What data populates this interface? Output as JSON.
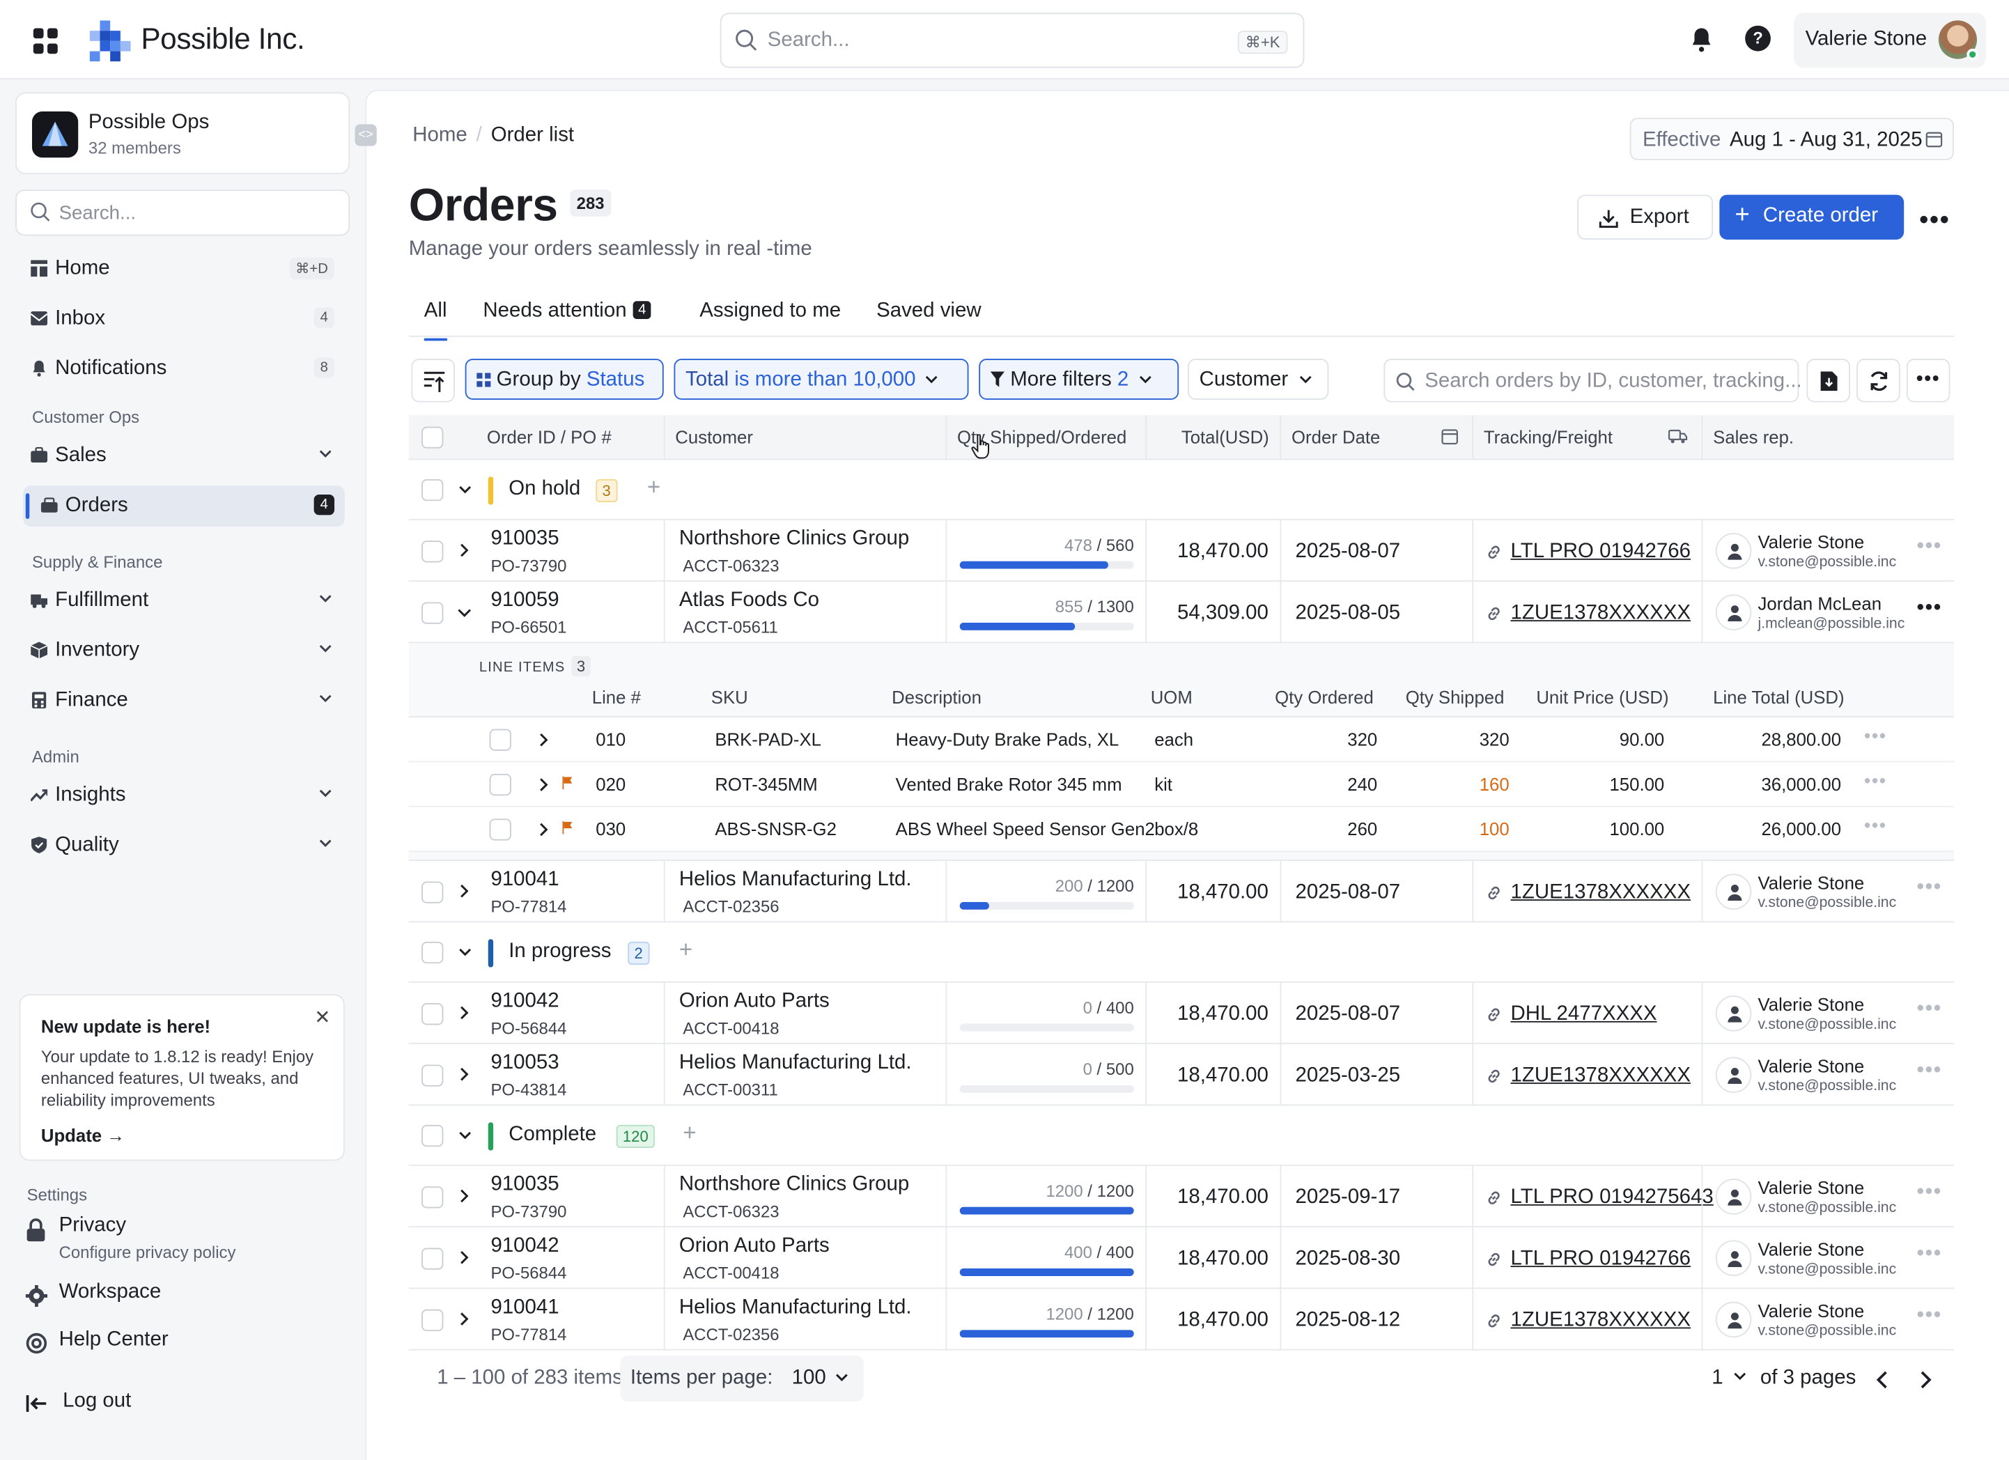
{
  "brand": {
    "name": "Possible Inc."
  },
  "top_search": {
    "placeholder": "Search...",
    "shortcut": "⌘+K"
  },
  "user": {
    "name": "Valerie Stone"
  },
  "workspace": {
    "name": "Possible Ops",
    "members": "32 members"
  },
  "sidebar": {
    "search_placeholder": "Search...",
    "home": {
      "label": "Home",
      "badge": "⌘+D"
    },
    "inbox": {
      "label": "Inbox",
      "badge": "4"
    },
    "notifications": {
      "label": "Notifications",
      "badge": "8"
    },
    "section_customer_ops": "Customer Ops",
    "sales": {
      "label": "Sales"
    },
    "orders": {
      "label": "Orders",
      "badge": "4"
    },
    "section_supply": "Supply & Finance",
    "fulfillment": {
      "label": "Fulfillment"
    },
    "inventory": {
      "label": "Inventory"
    },
    "finance": {
      "label": "Finance"
    },
    "section_admin": "Admin",
    "insights": {
      "label": "Insights"
    },
    "quality": {
      "label": "Quality"
    },
    "update": {
      "title": "New update is here!",
      "body": "Your update to 1.8.12 is ready! Enjoy enhanced features, UI tweaks, and reliability improvements",
      "link": "Update →"
    },
    "settings_label": "Settings",
    "privacy": {
      "label": "Privacy",
      "sub": "Configure privacy policy"
    },
    "workspace_item": "Workspace",
    "help_center": "Help Center",
    "logout": "Log out"
  },
  "breadcrumb": {
    "home": "Home",
    "current": "Order list"
  },
  "effective": {
    "label": "Effective",
    "range": "Aug 1 - Aug 31, 2025"
  },
  "page": {
    "title": "Orders",
    "count": "283",
    "subtitle": "Manage your orders seamlessly in real -time"
  },
  "actions": {
    "export": "Export",
    "create": "Create order"
  },
  "tabs": {
    "all": "All",
    "needs_attention": "Needs attention",
    "needs_attention_count": "4",
    "assigned": "Assigned to me",
    "saved": "Saved view"
  },
  "filters": {
    "group_by": "Group by",
    "group_by_value": "Status",
    "total": "Total",
    "total_op": "is more than",
    "total_value": "10,000",
    "more": "More filters",
    "more_count": "2",
    "customer": "Customer",
    "search_placeholder": "Search orders by ID, customer, tracking..."
  },
  "columns": {
    "order": "Order ID / PO #",
    "customer": "Customer",
    "qty": "Qty Shipped/Ordered",
    "total": "Total(USD)",
    "date": "Order Date",
    "tracking": "Tracking/Freight",
    "rep": "Sales rep."
  },
  "groups": {
    "on_hold": {
      "label": "On hold",
      "count": "3",
      "color": "#f2c230"
    },
    "in_progress": {
      "label": "In progress",
      "count": "2",
      "color": "#1f5fa8"
    },
    "complete": {
      "label": "Complete",
      "count": "120",
      "color": "#27a05a"
    }
  },
  "orders": [
    {
      "id": "910035",
      "po": "PO-73790",
      "customer": "Northshore Clinics Group",
      "acct": "ACCT-06323",
      "shipped": "478",
      "ordered": "560",
      "progress": 0.85,
      "total": "18,470.00",
      "date": "2025-08-07",
      "tracking": "LTL PRO 01942766",
      "rep": "Valerie Stone",
      "email": "v.stone@possible.inc"
    },
    {
      "id": "910059",
      "po": "PO-66501",
      "customer": "Atlas Foods Co",
      "acct": "ACCT-05611",
      "shipped": "855",
      "ordered": "1300",
      "progress": 0.66,
      "total": "54,309.00",
      "date": "2025-08-05",
      "tracking": "1ZUE1378XXXXXX",
      "rep": "Jordan McLean",
      "email": "j.mclean@possible.inc"
    },
    {
      "id": "910041",
      "po": "PO-77814",
      "customer": "Helios Manufacturing Ltd.",
      "acct": "ACCT-02356",
      "shipped": "200",
      "ordered": "1200",
      "progress": 0.17,
      "total": "18,470.00",
      "date": "2025-08-07",
      "tracking": "1ZUE1378XXXXXX",
      "rep": "Valerie Stone",
      "email": "v.stone@possible.inc"
    },
    {
      "id": "910042",
      "po": "PO-56844",
      "customer": "Orion Auto Parts",
      "acct": "ACCT-00418",
      "shipped": "0",
      "ordered": "400",
      "progress": 0,
      "total": "18,470.00",
      "date": "2025-08-07",
      "tracking": "DHL 2477XXXX",
      "rep": "Valerie Stone",
      "email": "v.stone@possible.inc"
    },
    {
      "id": "910053",
      "po": "PO-43814",
      "customer": "Helios Manufacturing Ltd.",
      "acct": "ACCT-00311",
      "shipped": "0",
      "ordered": "500",
      "progress": 0,
      "total": "18,470.00",
      "date": "2025-03-25",
      "tracking": "1ZUE1378XXXXXX",
      "rep": "Valerie Stone",
      "email": "v.stone@possible.inc"
    },
    {
      "id": "910035",
      "po": "PO-73790",
      "customer": "Northshore Clinics Group",
      "acct": "ACCT-06323",
      "shipped": "1200",
      "ordered": "1200",
      "progress": 1,
      "total": "18,470.00",
      "date": "2025-09-17",
      "tracking": "LTL PRO 0194275643",
      "rep": "Valerie Stone",
      "email": "v.stone@possible.inc"
    },
    {
      "id": "910042",
      "po": "PO-56844",
      "customer": "Orion Auto Parts",
      "acct": "ACCT-00418",
      "shipped": "400",
      "ordered": "400",
      "progress": 1,
      "total": "18,470.00",
      "date": "2025-08-30",
      "tracking": "LTL PRO 01942766",
      "rep": "Valerie Stone",
      "email": "v.stone@possible.inc"
    },
    {
      "id": "910041",
      "po": "PO-77814",
      "customer": "Helios Manufacturing Ltd.",
      "acct": "ACCT-02356",
      "shipped": "1200",
      "ordered": "1200",
      "progress": 1,
      "total": "18,470.00",
      "date": "2025-08-12",
      "tracking": "1ZUE1378XXXXXX",
      "rep": "Valerie Stone",
      "email": "v.stone@possible.inc"
    }
  ],
  "line_items": {
    "title": "LINE ITEMS",
    "count": "3",
    "headers": {
      "line": "Line #",
      "sku": "SKU",
      "desc": "Description",
      "uom": "UOM",
      "qty_ordered": "Qty Ordered",
      "qty_shipped": "Qty Shipped",
      "unit_price": "Unit Price (USD)",
      "line_total": "Line Total (USD)"
    },
    "rows": [
      {
        "line": "010",
        "sku": "BRK-PAD-XL",
        "desc": "Heavy-Duty Brake Pads, XL",
        "uom": "each",
        "ordered": "320",
        "shipped": "320",
        "price": "90.00",
        "total": "28,800.00"
      },
      {
        "line": "020",
        "sku": "ROT-345MM",
        "desc": "Vented Brake Rotor 345 mm",
        "uom": "kit",
        "ordered": "240",
        "shipped": "160",
        "price": "150.00",
        "total": "36,000.00"
      },
      {
        "line": "030",
        "sku": "ABS-SNSR-G2",
        "desc": "ABS Wheel Speed Sensor Gen2",
        "uom": "box/8",
        "ordered": "260",
        "shipped": "100",
        "price": "100.00",
        "total": "26,000.00"
      }
    ]
  },
  "footer": {
    "range": "1 – 100 of 283 items",
    "ipp_label": "Items per page:",
    "ipp_value": "100",
    "page": "1",
    "of_pages": "of 3 pages"
  }
}
